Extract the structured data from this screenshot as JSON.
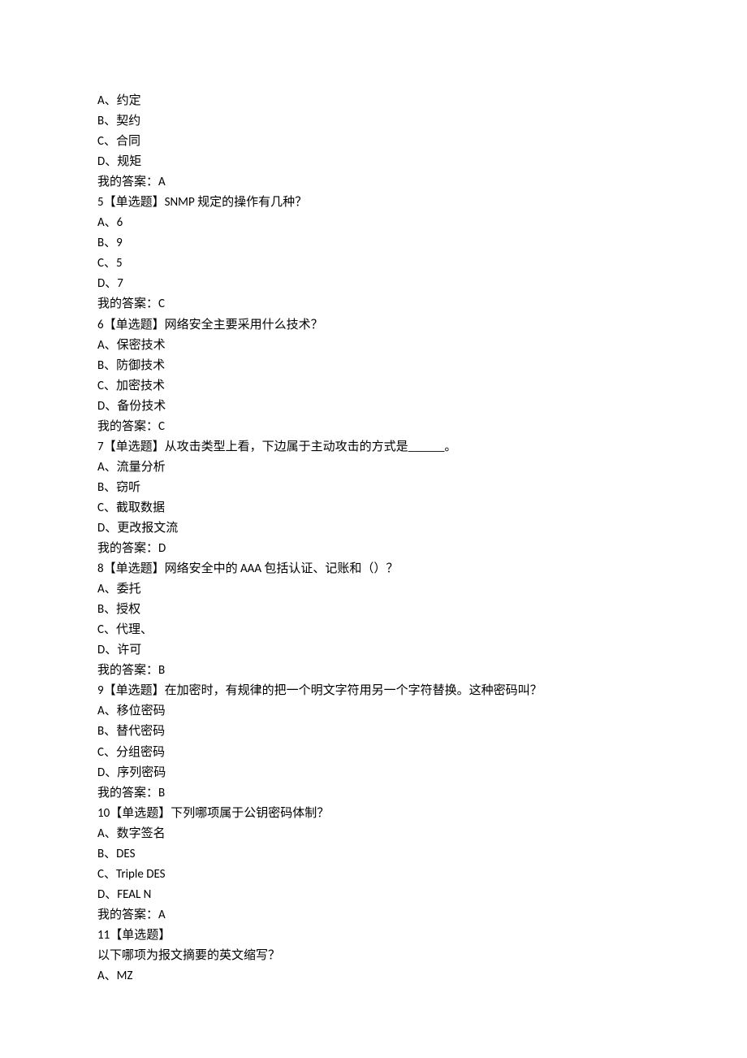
{
  "lines": [
    "A、约定",
    "B、契约",
    "C、合同",
    "D、规矩",
    "我的答案：A",
    "5【单选题】SNMP 规定的操作有几种？",
    "A、6",
    "B、9",
    "C、5",
    "D、7",
    "我的答案：C",
    "6【单选题】网络安全主要采用什么技术？",
    "A、保密技术",
    "B、防御技术",
    "C、加密技术",
    "D、备份技术",
    "我的答案：C",
    "7【单选题】从攻击类型上看，下边属于主动攻击的方式是______。",
    "A、流量分析",
    "B、窃听",
    "C、截取数据",
    "D、更改报文流",
    "我的答案：D",
    "8【单选题】网络安全中的 AAA 包括认证、记账和（）？",
    "A、委托",
    "B、授权",
    "C、代理、",
    "D、许可",
    "我的答案：B",
    "9【单选题】在加密时，有规律的把一个明文字符用另一个字符替换。这种密码叫？",
    "A、移位密码",
    "B、替代密码",
    "C、分组密码",
    "D、序列密码",
    "我的答案：B",
    "10【单选题】下列哪项属于公钥密码体制？",
    "A、数字签名",
    "B、DES",
    "C、Triple DES",
    "D、FEAL N",
    "我的答案：A",
    "11【单选题】",
    "以下哪项为报文摘要的英文缩写？",
    "A、MZ"
  ]
}
